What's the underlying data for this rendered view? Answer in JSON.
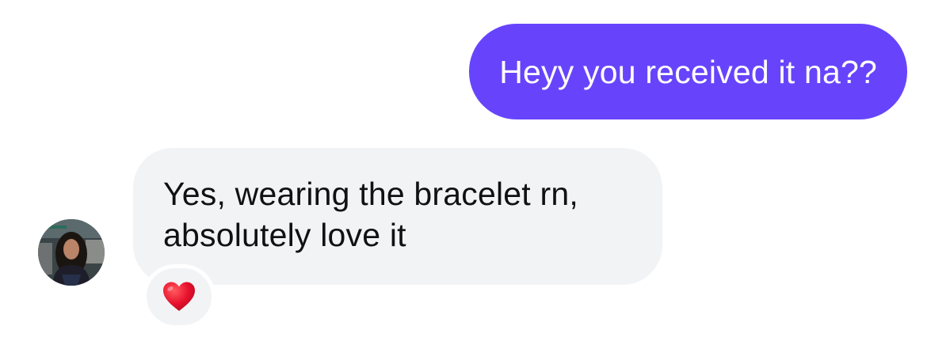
{
  "colors": {
    "outgoing_bubble": "#6744fc",
    "incoming_bubble": "#f2f3f5",
    "reaction_bg": "#f2f3f5",
    "heart": "#e8112d"
  },
  "messages": {
    "outgoing": {
      "text": "Heyy you received it na??"
    },
    "incoming": {
      "line1": "Yes, wearing the bracelet rn,",
      "line2": "absolutely love it"
    }
  },
  "reaction": {
    "icon": "red-heart-icon"
  },
  "avatar": {
    "icon": "profile-photo"
  }
}
